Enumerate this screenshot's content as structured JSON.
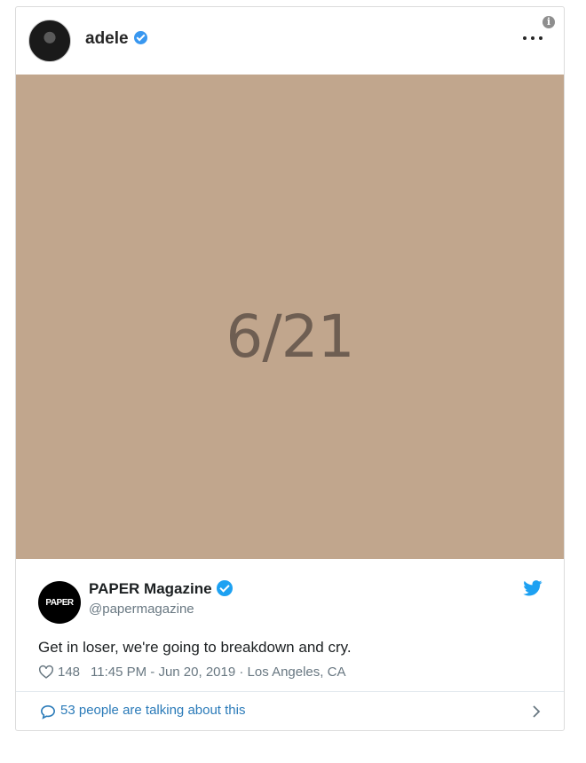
{
  "post": {
    "username": "adele",
    "image_text": "6/21"
  },
  "tweet": {
    "avatar_text": "PAPER",
    "name": "PAPER Magazine",
    "handle": "@papermagazine",
    "text": "Get in loser, we're going to breakdown and cry.",
    "likes": "148",
    "time": "11:45 PM - Jun 20, 2019",
    "separator": "·",
    "location": "Los Angeles, CA"
  },
  "footer": {
    "talking_text": "53 people are talking about this"
  },
  "icons": {
    "info": "info-icon",
    "more": "more-icon",
    "verified": "verified-icon",
    "twitter": "twitter-bird-icon",
    "heart": "heart-icon",
    "comment": "speech-bubble-icon",
    "chevron": "chevron-right-icon"
  },
  "colors": {
    "image_bg": "#c1a68d",
    "image_text": "#6e5e52",
    "twitter_blue": "#1da1f2",
    "link_blue": "#2b7bb9",
    "instagram_verified": "#3897f0"
  }
}
